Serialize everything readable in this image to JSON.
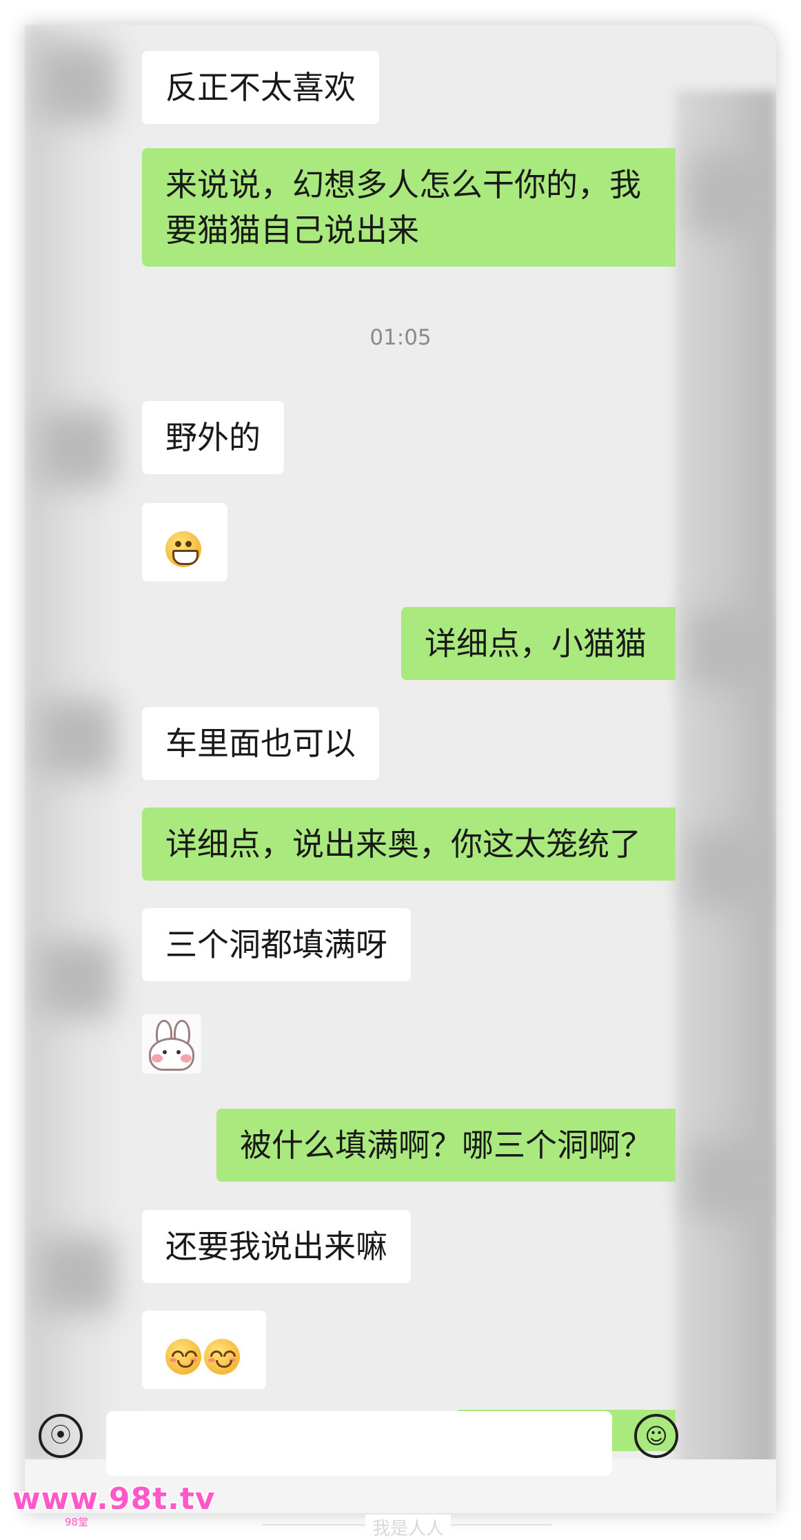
{
  "chat": {
    "messages": [
      {
        "side": "in",
        "text": "反正不太喜欢"
      },
      {
        "side": "out",
        "lines": [
          "来说说，幻想多人怎么干你的，我",
          "要猫猫自己说出来"
        ]
      },
      {
        "side": "in",
        "text": "野外的"
      },
      {
        "side": "in",
        "emoji": "grinning-face"
      },
      {
        "side": "out",
        "text": "详细点，小猫猫"
      },
      {
        "side": "in",
        "text": "车里面也可以"
      },
      {
        "side": "out",
        "text": "详细点，说出来奥，你这太笼统了"
      },
      {
        "side": "in",
        "text": "三个洞都填满呀"
      },
      {
        "side": "in",
        "sticker": "bunny-sticker"
      },
      {
        "side": "out",
        "text": "被什么填满啊？哪三个洞啊？"
      },
      {
        "side": "in",
        "text": "还要我说出来嘛"
      },
      {
        "side": "in",
        "emoji": "blushing-smile-x2"
      }
    ],
    "timestamp": "01:05"
  },
  "input_bar": {
    "voice_icon": "voice-icon",
    "emoji_icon": "emoji-icon"
  },
  "watermark": {
    "text": "www.98t.tv",
    "sub": "98堂",
    "footer": "我是人人"
  },
  "colors": {
    "background": "#ededed",
    "incoming_bubble": "#ffffff",
    "outgoing_bubble": "#a9e97d",
    "watermark": "#ff58c8"
  }
}
